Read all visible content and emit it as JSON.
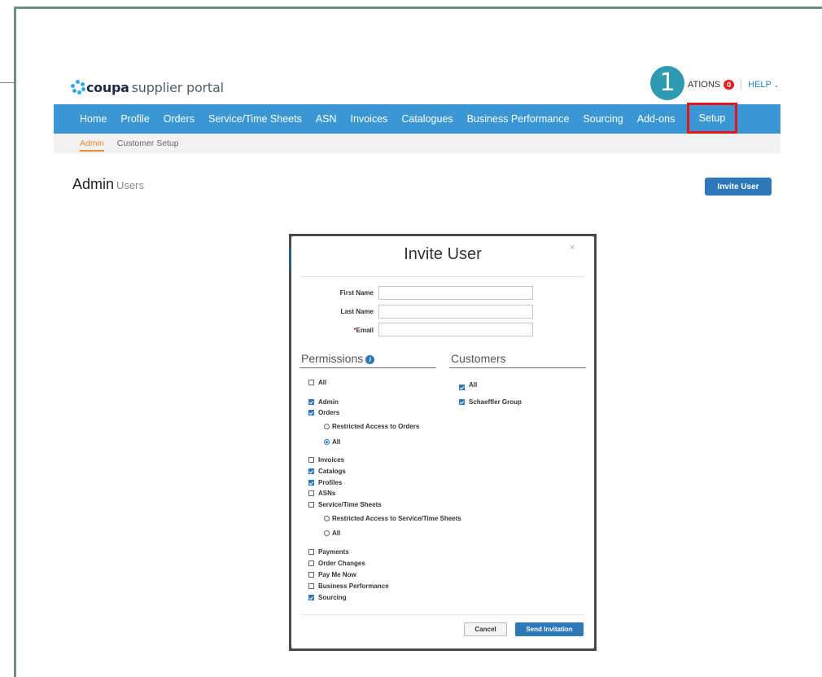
{
  "app": {
    "logo_brand": "coupa",
    "logo_rest": "supplier portal",
    "notifications_label": "ATIONS",
    "notifications_count": "0",
    "help_label": "HELP",
    "step_marker": "1"
  },
  "nav": {
    "items": [
      "Home",
      "Profile",
      "Orders",
      "Service/Time Sheets",
      "ASN",
      "Invoices",
      "Catalogues",
      "Business Performance",
      "Sourcing",
      "Add-ons"
    ],
    "setup": "Setup"
  },
  "subnav": {
    "admin": "Admin",
    "customer_setup": "Customer Setup"
  },
  "page": {
    "title": "Admin",
    "subtitle": "Users",
    "invite_button": "Invite User"
  },
  "modal": {
    "title": "Invite User",
    "close": "×",
    "fields": {
      "first_name": {
        "label": "First Name",
        "value": ""
      },
      "last_name": {
        "label": "Last Name",
        "value": ""
      },
      "email": {
        "label": "Email",
        "required_mark": "*",
        "value": ""
      }
    },
    "permissions_heading": "Permissions",
    "info_icon_glyph": "i",
    "customers_heading": "Customers",
    "permissions": [
      {
        "label": "All",
        "type": "checkbox",
        "checked": false
      },
      {
        "label": "Admin",
        "type": "checkbox",
        "checked": true
      },
      {
        "label": "Orders",
        "type": "checkbox",
        "checked": true
      },
      {
        "label": "Restricted Access to Orders",
        "type": "radio",
        "checked": false
      },
      {
        "label": "All",
        "type": "radio",
        "checked": true
      },
      {
        "label": "Invoices",
        "type": "checkbox",
        "checked": false
      },
      {
        "label": "Catalogs",
        "type": "checkbox",
        "checked": true
      },
      {
        "label": "Profiles",
        "type": "checkbox",
        "checked": true
      },
      {
        "label": "ASNs",
        "type": "checkbox",
        "checked": false
      },
      {
        "label": "Service/Time Sheets",
        "type": "checkbox",
        "checked": false
      },
      {
        "label": "Restricted Access to Service/Time Sheets",
        "type": "radio",
        "checked": false
      },
      {
        "label": "All",
        "type": "radio",
        "checked": false
      },
      {
        "label": "Payments",
        "type": "checkbox",
        "checked": false
      },
      {
        "label": "Order Changes",
        "type": "checkbox",
        "checked": false
      },
      {
        "label": "Pay Me Now",
        "type": "checkbox",
        "checked": false
      },
      {
        "label": "Business Performance",
        "type": "checkbox",
        "checked": false
      },
      {
        "label": "Sourcing",
        "type": "checkbox",
        "checked": true
      }
    ],
    "customers": [
      {
        "label": "All",
        "checked": true
      },
      {
        "label": "Schaeffler Group",
        "checked": true
      }
    ],
    "cancel_button": "Cancel",
    "send_button": "Send Invitation"
  },
  "colors": {
    "nav_blue": "#3a97d4",
    "button_blue": "#2c78b8",
    "highlight_red": "#e3161d",
    "step_badge": "#2f9bb0",
    "active_tab": "#e88a2a"
  }
}
